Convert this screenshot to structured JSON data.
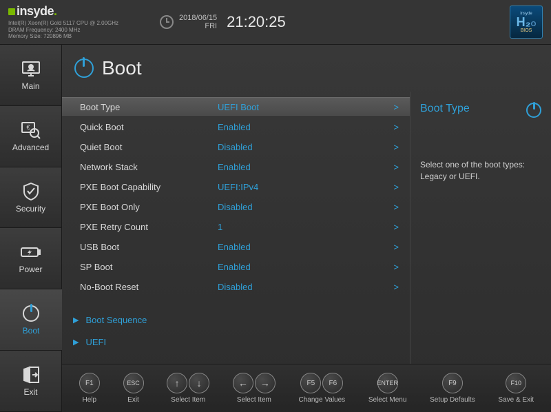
{
  "brand": "insyde",
  "system_info": {
    "cpu": "Intel(R) Xeon(R) Gold 5117 CPU @ 2.00GHz",
    "dram": "DRAM Frequency: 2400 MHz",
    "memory": "Memory Size: 720896 MB"
  },
  "datetime": {
    "date": "2018/06/15",
    "day": "FRI",
    "time": "21:20:25"
  },
  "h2o": {
    "top": "insyde",
    "main": "H₂",
    "o": "O",
    "bios": "BIOS"
  },
  "sidebar": [
    {
      "label": "Main"
    },
    {
      "label": "Advanced"
    },
    {
      "label": "Security"
    },
    {
      "label": "Power"
    },
    {
      "label": "Boot"
    },
    {
      "label": "Exit"
    }
  ],
  "page": {
    "title": "Boot"
  },
  "settings": [
    {
      "label": "Boot Type",
      "value": "UEFI Boot"
    },
    {
      "label": "Quick Boot",
      "value": "Enabled"
    },
    {
      "label": "Quiet Boot",
      "value": "Disabled"
    },
    {
      "label": "Network Stack",
      "value": "Enabled"
    },
    {
      "label": "PXE Boot Capability",
      "value": "UEFI:IPv4"
    },
    {
      "label": "PXE Boot Only",
      "value": "Disabled"
    },
    {
      "label": "PXE Retry Count",
      "value": "1"
    },
    {
      "label": "USB Boot",
      "value": "Enabled"
    },
    {
      "label": "SP Boot",
      "value": "Enabled"
    },
    {
      "label": "No-Boot Reset",
      "value": "Disabled"
    }
  ],
  "submenus": [
    {
      "label": "Boot Sequence"
    },
    {
      "label": "UEFI"
    }
  ],
  "help": {
    "title": "Boot Type",
    "text": "Select one of the boot types: Legacy or UEFI."
  },
  "footer": [
    {
      "keys": [
        "F1"
      ],
      "label": "Help"
    },
    {
      "keys": [
        "ESC"
      ],
      "label": "Exit"
    },
    {
      "keys": [
        "↑",
        "↓"
      ],
      "label": "Select Item",
      "arrow": true
    },
    {
      "keys": [
        "←",
        "→"
      ],
      "label": "Select Item",
      "arrow": true
    },
    {
      "keys": [
        "F5",
        "F6"
      ],
      "label": "Change Values"
    },
    {
      "keys": [
        "ENTER"
      ],
      "label": "Select Menu"
    },
    {
      "keys": [
        "F9"
      ],
      "label": "Setup Defaults"
    },
    {
      "keys": [
        "F10"
      ],
      "label": "Save & Exit"
    }
  ]
}
